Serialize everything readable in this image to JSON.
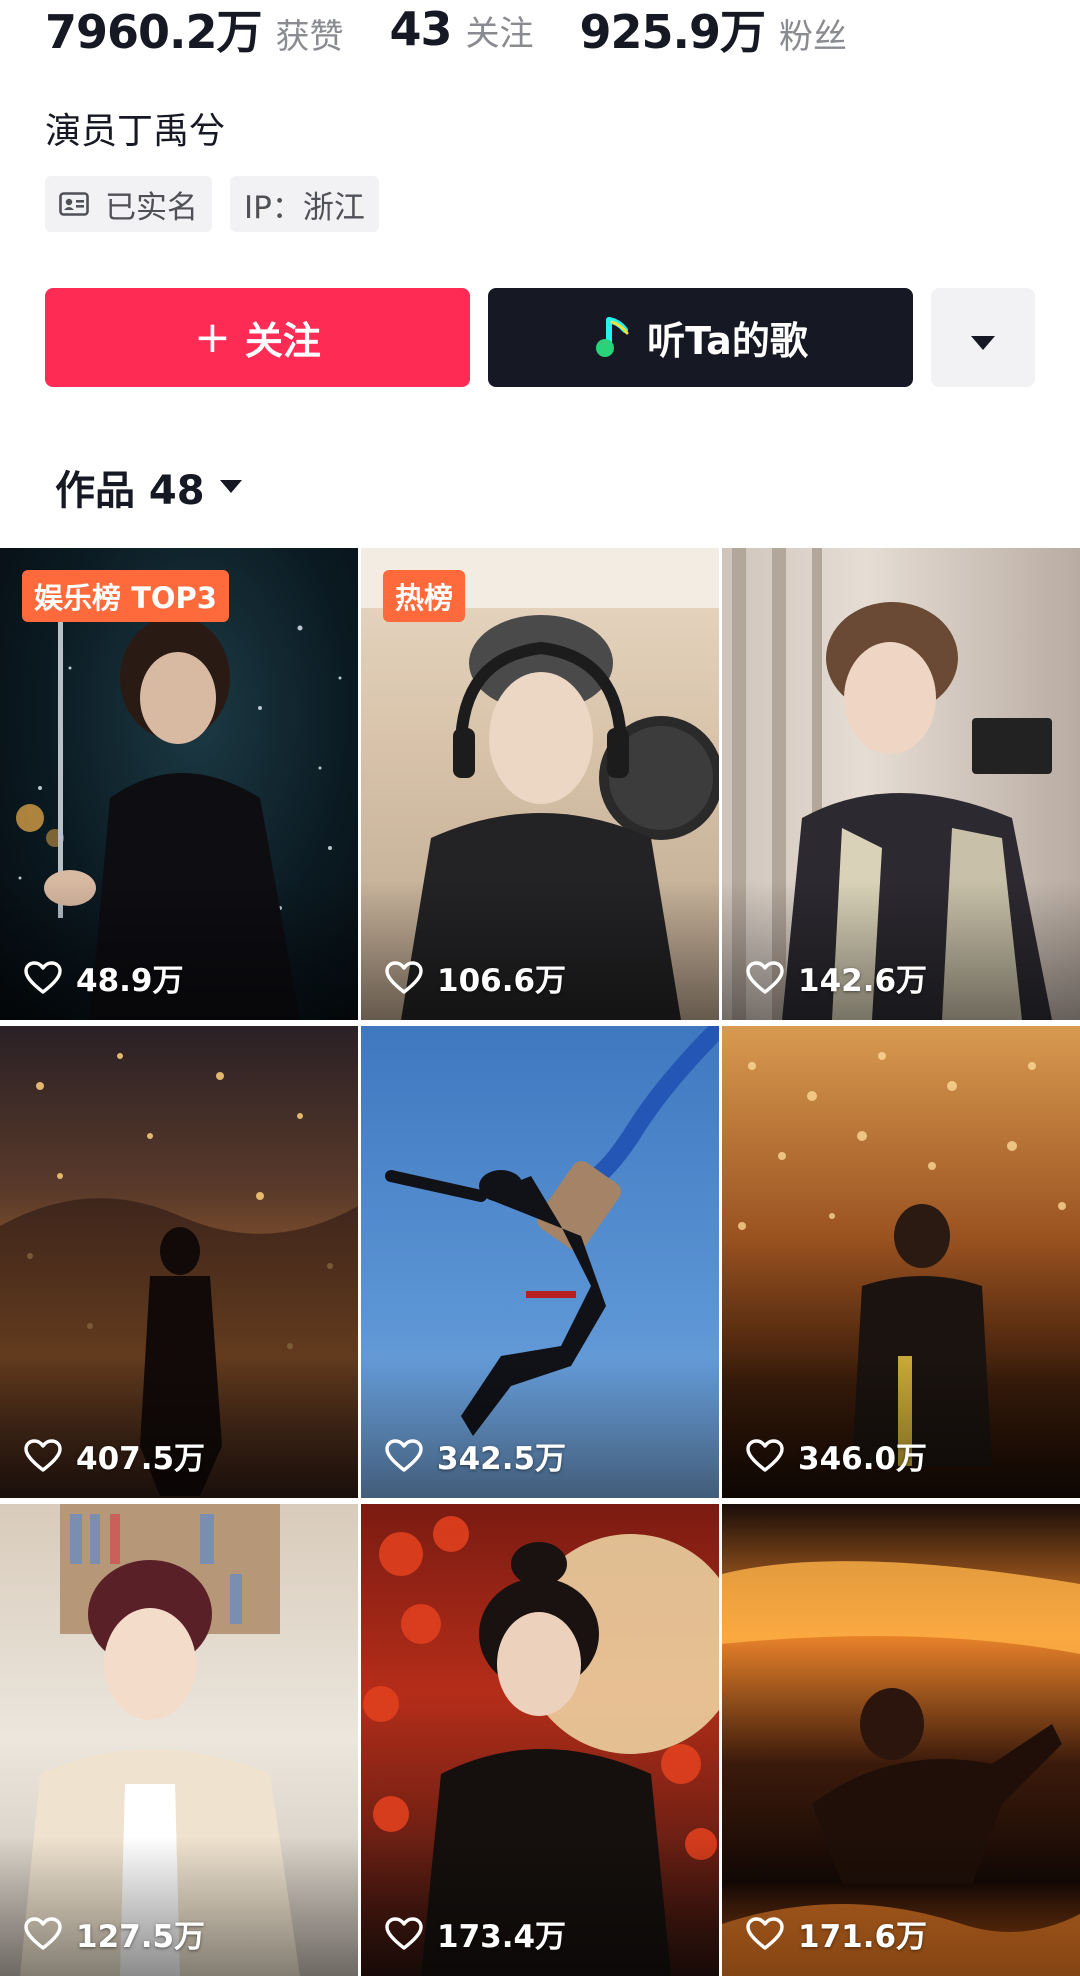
{
  "stats": [
    {
      "value": "7960.2万",
      "label": "获赞"
    },
    {
      "value": "43",
      "label": "关注"
    },
    {
      "value": "925.9万",
      "label": "粉丝"
    }
  ],
  "bio": "演员丁禹兮",
  "tags": {
    "verified": "已实名",
    "ip": "IP：浙江"
  },
  "actions": {
    "follow_label": "关注",
    "music_label": "听Ta的歌"
  },
  "works": {
    "label": "作品 48"
  },
  "colors": {
    "follow": "#fe2c55",
    "music": "#161823",
    "badge": "#ff6a3d"
  },
  "videos": [
    {
      "likes": "48.9万",
      "badge": "娱乐榜 TOP3"
    },
    {
      "likes": "106.6万",
      "badge": "热榜"
    },
    {
      "likes": "142.6万"
    },
    {
      "likes": "407.5万"
    },
    {
      "likes": "342.5万"
    },
    {
      "likes": "346.0万"
    },
    {
      "likes": "127.5万"
    },
    {
      "likes": "173.4万"
    },
    {
      "likes": "171.6万"
    }
  ]
}
